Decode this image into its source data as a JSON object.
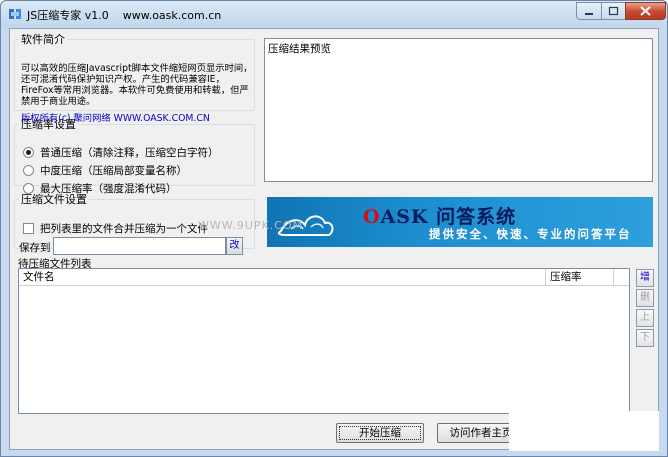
{
  "window": {
    "title": "JS压缩专家 v1.0    www.oask.com.cn"
  },
  "intro": {
    "legend": "软件简介",
    "text": "可以高效的压缩Javascript脚本文件缩短网页显示时间，还可混淆代码保护知识产权。产生的代码兼容IE，FireFox等常用浏览器。本软件可免费使用和转载，但严禁用于商业用途。",
    "copyright": "版权所有(c) 聚问网络 WWW.OASK.COM.CN"
  },
  "compression": {
    "legend": "压缩率设置",
    "options": [
      {
        "label": "普通压缩（清除注释，压缩空白字符）",
        "selected": true
      },
      {
        "label": "中度压缩（压缩局部变量名称）",
        "selected": false
      },
      {
        "label": "最大压缩率（强度混淆代码）",
        "selected": false
      }
    ]
  },
  "file_settings": {
    "legend": "压缩文件设置",
    "merge_label": "把列表里的文件合并压缩为一个文件",
    "merge_checked": false,
    "save_label": "保存到",
    "save_value": "",
    "browse_label": "改"
  },
  "preview": {
    "label": "压缩结果预览"
  },
  "banner": {
    "title_o": "O",
    "title_rest": "ASK 问答系统",
    "subtitle": "提供安全、快速、专业的问答平台",
    "watermark": "WWW.9UPK.COM"
  },
  "file_list": {
    "label": "待压缩文件列表",
    "columns": [
      "文件名",
      "压缩率"
    ],
    "rows": []
  },
  "side_buttons": [
    {
      "label": "增",
      "enabled": true
    },
    {
      "label": "删",
      "enabled": false
    },
    {
      "label": "上",
      "enabled": false
    },
    {
      "label": "下",
      "enabled": false
    }
  ],
  "actions": {
    "start": "开始压缩",
    "visit": "访问作者主页"
  },
  "colors": {
    "window_frame": "#c6d9ee",
    "link": "#0000cc",
    "banner_blue": "#1d8fd0",
    "close_red": "#c8472c"
  }
}
